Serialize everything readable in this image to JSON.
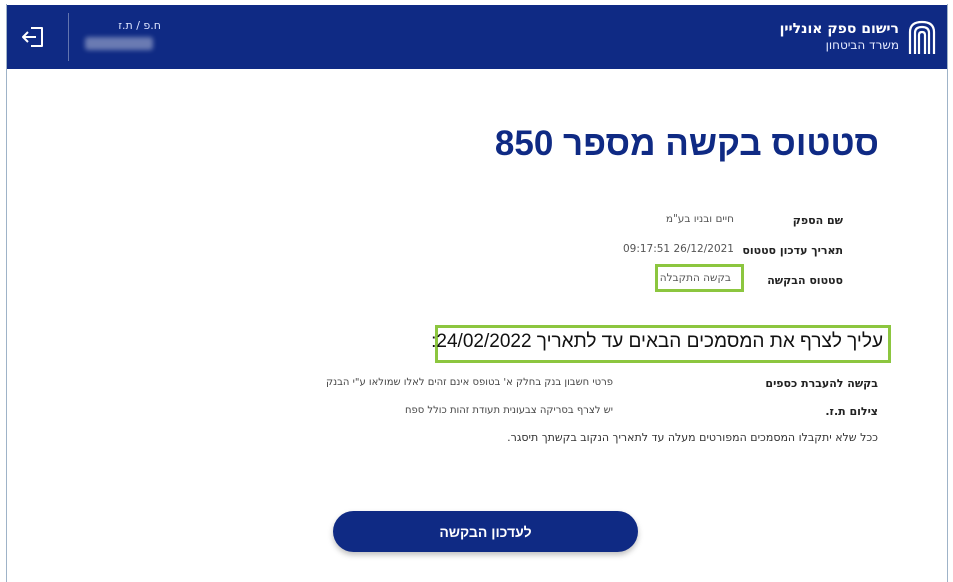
{
  "header": {
    "brand_title": "רישום ספק אונליין",
    "brand_subtitle": "משרד הביטחון",
    "id_label": "ח.פ / ת.ז",
    "id_value_redacted": true,
    "icons": {
      "logout": "logout-icon",
      "logo": "ministry-logo-icon"
    }
  },
  "main": {
    "title": "סטטוס בקשה מספר 850",
    "details": [
      {
        "label": "שם הספק",
        "value": "חיים ובניו בע\"מ"
      },
      {
        "label": "תאריך עדכון סטטוס",
        "value": "26/12/2021 09:17:51"
      },
      {
        "label": "סטטוס הבקשה",
        "value": "בקשה התקבלה"
      }
    ],
    "notice": "עליך לצרף את המסמכים הבאים עד לתאריך 24/02/2022:",
    "documents": [
      {
        "name": "בקשה להעברת כספים",
        "description": "פרטי חשבון בנק בחלק א' בטופס אינם זהים לאלו שמולאו ע\"י הבנק"
      },
      {
        "name": "צילום ת.ז.",
        "description": "יש לצרף בסריקה צבעונית תעודת זהות כולל ספח"
      }
    ],
    "footer_note": "ככל שלא יתקבלו המסמכים המפורטים מעלה עד לתאריך הנקוב בקשתך תיסגר.",
    "submit_label": "לעדכון הבקשה",
    "highlight_color": "#8cc63f",
    "brand_color": "#0f2a84"
  }
}
